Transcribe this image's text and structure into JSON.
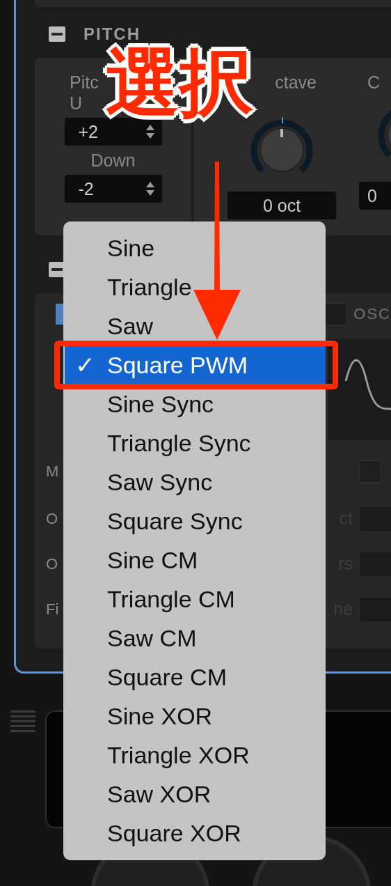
{
  "pitch": {
    "title": "PITCH",
    "pitch_label": "Pitc",
    "up_label": "U",
    "up_value": "+2",
    "down_label": "Down",
    "down_value": "-2",
    "octave_label": "ctave",
    "octave_value": "0 oct",
    "column_3_label": "C",
    "column_3_value": "0"
  },
  "oscillator": {
    "tab_label": "OSC",
    "checkbox": {
      "checked": false
    },
    "rows": [
      {
        "left": "M",
        "right": ""
      },
      {
        "left": "O",
        "right": "ct"
      },
      {
        "left": "O",
        "right": "rs"
      },
      {
        "left": "Fi",
        "right": "ne"
      }
    ]
  },
  "menu": {
    "check_mark": "✓",
    "items": [
      {
        "label": "Sine",
        "selected": false
      },
      {
        "label": "Triangle",
        "selected": false
      },
      {
        "label": "Saw",
        "selected": false
      },
      {
        "label": "Square PWM",
        "selected": true
      },
      {
        "label": "Sine Sync",
        "selected": false
      },
      {
        "label": "Triangle Sync",
        "selected": false
      },
      {
        "label": "Saw Sync",
        "selected": false
      },
      {
        "label": "Square Sync",
        "selected": false
      },
      {
        "label": "Sine CM",
        "selected": false
      },
      {
        "label": "Triangle CM",
        "selected": false
      },
      {
        "label": "Saw CM",
        "selected": false
      },
      {
        "label": "Square CM",
        "selected": false
      },
      {
        "label": "Sine XOR",
        "selected": false
      },
      {
        "label": "Triangle XOR",
        "selected": false
      },
      {
        "label": "Saw XOR",
        "selected": false
      },
      {
        "label": "Square XOR",
        "selected": false
      }
    ]
  },
  "annotation": {
    "label": "選択"
  }
}
